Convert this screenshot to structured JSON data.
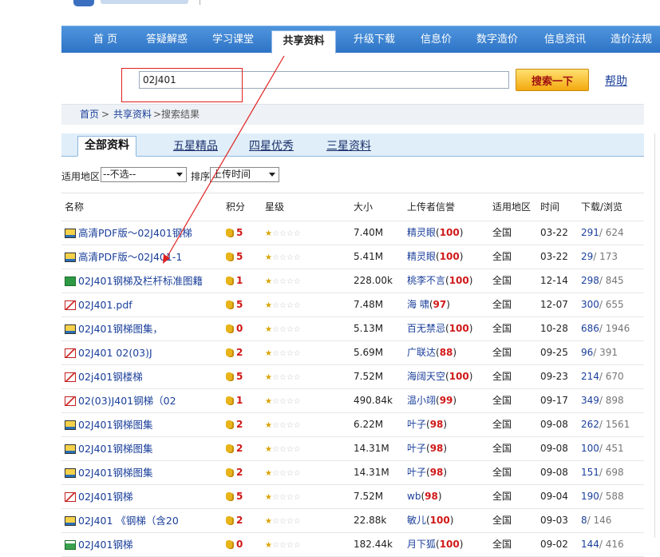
{
  "nav": {
    "items": [
      {
        "label": "首 页"
      },
      {
        "label": "答疑解惑"
      },
      {
        "label": "学习课堂"
      },
      {
        "label": "共享资料"
      },
      {
        "label": "升级下载"
      },
      {
        "label": "信息价"
      },
      {
        "label": "数字造价"
      },
      {
        "label": "信息资讯"
      },
      {
        "label": "造价法规"
      }
    ]
  },
  "search": {
    "value": "02J401",
    "button_label": "搜索一下",
    "help_label": "帮助"
  },
  "breadcrumb": {
    "home": "首页",
    "sep1": ">",
    "section": "共享资料",
    "current": ">搜索结果"
  },
  "filter_tabs": [
    "全部资料",
    "五星精品",
    "四星优秀",
    "三星资料"
  ],
  "filters": {
    "region_label": "适用地区",
    "region_value": "--不选--",
    "sort_label": "排序",
    "sort_value": "上传时间"
  },
  "columns": {
    "name": "名称",
    "score": "积分",
    "stars": "星级",
    "size": "大小",
    "uploader": "上传者信誉",
    "area": "适用地区",
    "time": "时间",
    "dl": "下载/浏览"
  },
  "rows": [
    {
      "icon": "doc",
      "name": "高清PDF版～02J401钢梯",
      "score": "5",
      "stars": 1,
      "size": "7.40M",
      "uploader": "精灵眼",
      "credit": "100",
      "area": "全国",
      "time": "03-22",
      "downloads": "291",
      "views": "/ 624"
    },
    {
      "icon": "doc",
      "name": "高清PDF版～02J401-1",
      "score": "5",
      "stars": 1,
      "size": "5.41M",
      "uploader": "精灵眼",
      "credit": "100",
      "area": "全国",
      "time": "03-22",
      "downloads": "29",
      "views": "/ 173"
    },
    {
      "icon": "xls",
      "name": "02J401钢梯及栏杆标准图籍",
      "score": "1",
      "stars": 1,
      "size": "228.00k",
      "uploader": "桃李不言",
      "credit": "100",
      "area": "全国",
      "time": "12-14",
      "downloads": "298",
      "views": "/ 845"
    },
    {
      "icon": "pdf",
      "name": "02J401.pdf",
      "score": "5",
      "stars": 1,
      "size": "7.48M",
      "uploader": "海 啸",
      "credit": "97",
      "area": "全国",
      "time": "12-07",
      "downloads": "300",
      "views": "/ 655"
    },
    {
      "icon": "doc",
      "name": "02J401钢梯图集，",
      "score": "0",
      "stars": 1,
      "size": "5.13M",
      "uploader": "百无禁忌",
      "credit": "100",
      "area": "全国",
      "time": "10-28",
      "downloads": "686",
      "views": "/ 1946"
    },
    {
      "icon": "pdf",
      "name": "02J401 02(03)J",
      "score": "2",
      "stars": 1,
      "size": "5.69M",
      "uploader": "广联达",
      "credit": "88",
      "area": "全国",
      "time": "09-25",
      "downloads": "96",
      "views": "/ 391"
    },
    {
      "icon": "pdf",
      "name": "02j401钢楼梯",
      "score": "5",
      "stars": 1,
      "size": "7.52M",
      "uploader": "海阔天空",
      "credit": "100",
      "area": "全国",
      "time": "09-23",
      "downloads": "214",
      "views": "/ 670"
    },
    {
      "icon": "pdf",
      "name": "02(03)J401钢梯（02",
      "score": "1",
      "stars": 1,
      "size": "490.84k",
      "uploader": "温小翊",
      "credit": "99",
      "area": "全国",
      "time": "09-17",
      "downloads": "349",
      "views": "/ 898"
    },
    {
      "icon": "doc",
      "name": "02J401钢梯图集",
      "score": "2",
      "stars": 1,
      "size": "6.22M",
      "uploader": "叶子",
      "credit": "98",
      "area": "全国",
      "time": "09-08",
      "downloads": "262",
      "views": "/ 1561"
    },
    {
      "icon": "doc",
      "name": "02J401钢梯图集",
      "score": "2",
      "stars": 1,
      "size": "14.31M",
      "uploader": "叶子",
      "credit": "98",
      "area": "全国",
      "time": "09-08",
      "downloads": "100",
      "views": "/ 451"
    },
    {
      "icon": "doc",
      "name": "02J401钢梯图集",
      "score": "2",
      "stars": 1,
      "size": "14.31M",
      "uploader": "叶子",
      "credit": "98",
      "area": "全国",
      "time": "09-08",
      "downloads": "151",
      "views": "/ 698"
    },
    {
      "icon": "pdf",
      "name": "02J401钢梯",
      "score": "5",
      "stars": 1,
      "size": "7.52M",
      "uploader": "wb",
      "credit": "98",
      "area": "全国",
      "time": "09-04",
      "downloads": "190",
      "views": "/ 588"
    },
    {
      "icon": "doc",
      "name": "02J401 《钢梯（含20",
      "score": "2",
      "stars": 1,
      "size": "22.88k",
      "uploader": "敏儿",
      "credit": "100",
      "area": "全国",
      "time": "09-03",
      "downloads": "8",
      "views": "/ 146"
    },
    {
      "icon": "zip",
      "name": "02J401钢梯",
      "score": "0",
      "stars": 1,
      "size": "182.44k",
      "uploader": "月下狐",
      "credit": "100",
      "area": "全国",
      "time": "09-02",
      "downloads": "144",
      "views": "/ 416"
    }
  ],
  "colors": {
    "nav_blue": "#2e73c6",
    "accent_red": "#d01818",
    "link_blue": "#1a3f9a",
    "highlight": "#e02020"
  }
}
